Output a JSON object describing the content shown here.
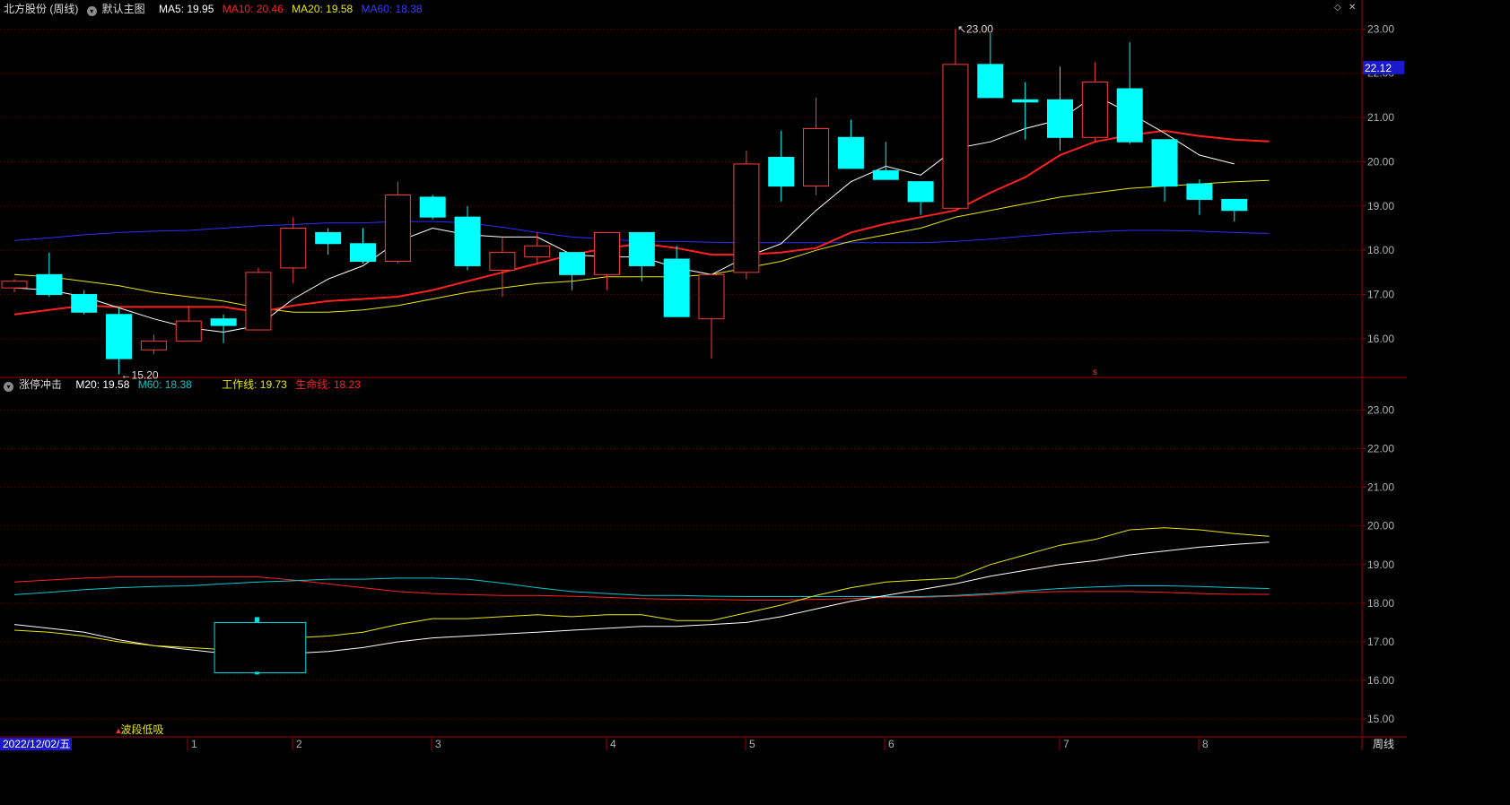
{
  "main_panel": {
    "stock_title": "北方股份 (周线)",
    "template_label": "默认主图",
    "ma5_text": "MA5: 19.95",
    "ma10_text": "MA10: 20.46",
    "ma20_text": "MA20: 19.58",
    "ma60_text": "MA60: 18.38",
    "high_marker": "23.00",
    "low_marker": "15.20",
    "price_tag": "22.12",
    "signal_marker": "s",
    "y_ticks": [
      "23.00",
      "22.00",
      "21.00",
      "20.00",
      "19.00",
      "18.00",
      "17.00",
      "16.00"
    ],
    "colors": {
      "up": "#ff3b3b",
      "down": "#00ffff",
      "ma5": "#ffffff",
      "ma10": "#ff2020",
      "ma20": "#e8e800",
      "ma60": "#2d2dff"
    }
  },
  "sub_panel": {
    "indicator_name": "涨停冲击",
    "m20_text": "M20: 19.58",
    "m60_text": "M60: 18.38",
    "work_line_text": "工作线: 19.73",
    "life_line_text": "生命线: 18.23",
    "signal_label": "波段低吸",
    "y_ticks": [
      "23.00",
      "22.00",
      "21.00",
      "20.00",
      "19.00",
      "18.00",
      "17.00",
      "16.00",
      "15.00"
    ]
  },
  "bottom_axis": {
    "date_label": "2022/12/02/五",
    "month_labels": [
      "1",
      "2",
      "3",
      "4",
      "5",
      "6",
      "7",
      "8"
    ],
    "period_label": "周线"
  },
  "chart_data": {
    "type": "candlestick",
    "candles": [
      {
        "o": 17.15,
        "c": 17.3,
        "h": 17.35,
        "l": 17.05
      },
      {
        "o": 17.45,
        "c": 17.0,
        "h": 17.95,
        "l": 16.95
      },
      {
        "o": 17.0,
        "c": 16.6,
        "h": 17.1,
        "l": 16.55
      },
      {
        "o": 16.55,
        "c": 15.55,
        "h": 16.7,
        "l": 15.2
      },
      {
        "o": 15.75,
        "c": 15.95,
        "h": 16.1,
        "l": 15.65
      },
      {
        "o": 15.95,
        "c": 16.4,
        "h": 16.75,
        "l": 15.95
      },
      {
        "o": 16.45,
        "c": 16.3,
        "h": 16.55,
        "l": 15.9
      },
      {
        "o": 16.2,
        "c": 17.5,
        "h": 17.6,
        "l": 16.2
      },
      {
        "o": 17.6,
        "c": 18.5,
        "h": 18.75,
        "l": 17.25
      },
      {
        "o": 18.4,
        "c": 18.15,
        "h": 18.5,
        "l": 17.9
      },
      {
        "o": 18.15,
        "c": 17.75,
        "h": 18.5,
        "l": 17.7
      },
      {
        "o": 17.75,
        "c": 19.25,
        "h": 19.55,
        "l": 17.7
      },
      {
        "o": 19.2,
        "c": 18.75,
        "h": 19.25,
        "l": 18.7
      },
      {
        "o": 18.75,
        "c": 17.65,
        "h": 19.0,
        "l": 17.55
      },
      {
        "o": 17.55,
        "c": 17.95,
        "h": 18.3,
        "l": 16.95
      },
      {
        "o": 17.85,
        "c": 18.1,
        "h": 18.4,
        "l": 17.7
      },
      {
        "o": 17.95,
        "c": 17.45,
        "h": 17.95,
        "l": 17.1
      },
      {
        "o": 17.45,
        "c": 18.4,
        "h": 18.4,
        "l": 17.1
      },
      {
        "o": 18.4,
        "c": 17.65,
        "h": 18.4,
        "l": 17.3
      },
      {
        "o": 17.8,
        "c": 16.5,
        "h": 18.1,
        "l": 16.5
      },
      {
        "o": 16.45,
        "c": 17.45,
        "h": 17.45,
        "l": 15.55
      },
      {
        "o": 17.5,
        "c": 19.95,
        "h": 20.25,
        "l": 17.35
      },
      {
        "o": 20.1,
        "c": 19.45,
        "h": 20.7,
        "l": 19.1
      },
      {
        "o": 19.45,
        "c": 20.75,
        "h": 21.45,
        "l": 19.25
      },
      {
        "o": 20.55,
        "c": 19.85,
        "h": 20.95,
        "l": 19.85
      },
      {
        "o": 19.8,
        "c": 19.6,
        "h": 20.45,
        "l": 19.6
      },
      {
        "o": 19.55,
        "c": 19.1,
        "h": 19.55,
        "l": 18.8
      },
      {
        "o": 18.95,
        "c": 22.2,
        "h": 23.0,
        "l": 18.95
      },
      {
        "o": 22.2,
        "c": 21.45,
        "h": 22.9,
        "l": 21.45
      },
      {
        "o": 21.4,
        "c": 21.35,
        "h": 21.8,
        "l": 20.5
      },
      {
        "o": 21.4,
        "c": 20.55,
        "h": 22.15,
        "l": 20.25
      },
      {
        "o": 20.55,
        "c": 21.8,
        "h": 22.25,
        "l": 20.45
      },
      {
        "o": 21.65,
        "c": 20.45,
        "h": 22.7,
        "l": 20.4
      },
      {
        "o": 20.5,
        "c": 19.45,
        "h": 20.5,
        "l": 19.1
      },
      {
        "o": 19.5,
        "c": 19.15,
        "h": 19.6,
        "l": 18.8
      },
      {
        "o": 19.15,
        "c": 18.9,
        "h": 19.15,
        "l": 18.65
      }
    ],
    "ma5": [
      17.15,
      17.1,
      16.95,
      16.7,
      16.45,
      16.25,
      16.15,
      16.3,
      16.9,
      17.35,
      17.65,
      18.2,
      18.5,
      18.35,
      18.3,
      18.3,
      17.9,
      17.85,
      17.85,
      17.6,
      17.45,
      17.85,
      18.15,
      18.9,
      19.55,
      19.9,
      19.7,
      20.3,
      20.45,
      20.75,
      20.95,
      21.5,
      21.1,
      20.65,
      20.15,
      19.95
    ],
    "ma10": [
      16.55,
      16.65,
      16.75,
      16.72,
      16.72,
      16.72,
      16.72,
      16.6,
      16.75,
      16.85,
      16.9,
      16.95,
      17.1,
      17.3,
      17.5,
      17.7,
      17.9,
      18.05,
      18.15,
      18.05,
      17.9,
      17.9,
      17.95,
      18.05,
      18.4,
      18.6,
      18.75,
      18.9,
      19.3,
      19.65,
      20.15,
      20.45,
      20.6,
      20.7,
      20.58,
      20.5,
      20.46
    ],
    "ma20": [
      17.45,
      17.4,
      17.3,
      17.2,
      17.05,
      16.95,
      16.85,
      16.7,
      16.6,
      16.6,
      16.65,
      16.75,
      16.9,
      17.05,
      17.15,
      17.25,
      17.3,
      17.4,
      17.4,
      17.4,
      17.45,
      17.6,
      17.75,
      18.0,
      18.2,
      18.35,
      18.5,
      18.75,
      18.9,
      19.05,
      19.2,
      19.3,
      19.4,
      19.45,
      19.5,
      19.55,
      19.58
    ],
    "ma60": [
      18.22,
      18.28,
      18.35,
      18.4,
      18.43,
      18.45,
      18.5,
      18.55,
      18.58,
      18.62,
      18.62,
      18.65,
      18.65,
      18.62,
      18.52,
      18.4,
      18.3,
      18.25,
      18.2,
      18.2,
      18.18,
      18.17,
      18.17,
      18.17,
      18.17,
      18.17,
      18.17,
      18.2,
      18.25,
      18.32,
      18.38,
      18.42,
      18.45,
      18.45,
      18.43,
      18.4,
      18.38
    ],
    "sub_work": [
      17.3,
      17.25,
      17.15,
      17.0,
      16.9,
      16.85,
      16.8,
      17.0,
      17.1,
      17.15,
      17.25,
      17.45,
      17.6,
      17.6,
      17.65,
      17.7,
      17.65,
      17.7,
      17.7,
      17.55,
      17.55,
      17.75,
      17.95,
      18.2,
      18.4,
      18.55,
      18.6,
      18.65,
      19.0,
      19.25,
      19.5,
      19.65,
      19.9,
      19.95,
      19.9,
      19.8,
      19.73
    ],
    "sub_white": [
      17.45,
      17.35,
      17.25,
      17.05,
      16.9,
      16.8,
      16.7,
      16.65,
      16.7,
      16.75,
      16.85,
      17.0,
      17.1,
      17.15,
      17.2,
      17.25,
      17.3,
      17.35,
      17.4,
      17.4,
      17.45,
      17.5,
      17.65,
      17.85,
      18.05,
      18.2,
      18.35,
      18.5,
      18.7,
      18.85,
      19.0,
      19.1,
      19.25,
      19.35,
      19.45,
      19.52,
      19.58
    ],
    "sub_teal": [
      18.22,
      18.28,
      18.35,
      18.4,
      18.43,
      18.45,
      18.5,
      18.55,
      18.58,
      18.62,
      18.62,
      18.65,
      18.65,
      18.62,
      18.52,
      18.4,
      18.3,
      18.25,
      18.2,
      18.2,
      18.18,
      18.17,
      18.17,
      18.17,
      18.17,
      18.17,
      18.17,
      18.2,
      18.25,
      18.32,
      18.38,
      18.42,
      18.45,
      18.45,
      18.43,
      18.4,
      18.38
    ],
    "sub_red": [
      18.55,
      18.6,
      18.65,
      18.68,
      18.68,
      18.68,
      18.68,
      18.68,
      18.6,
      18.5,
      18.4,
      18.3,
      18.25,
      18.22,
      18.2,
      18.2,
      18.18,
      18.15,
      18.12,
      18.1,
      18.1,
      18.08,
      18.08,
      18.1,
      18.12,
      18.15,
      18.15,
      18.18,
      18.22,
      18.28,
      18.3,
      18.3,
      18.3,
      18.28,
      18.25,
      18.23,
      18.23
    ]
  }
}
